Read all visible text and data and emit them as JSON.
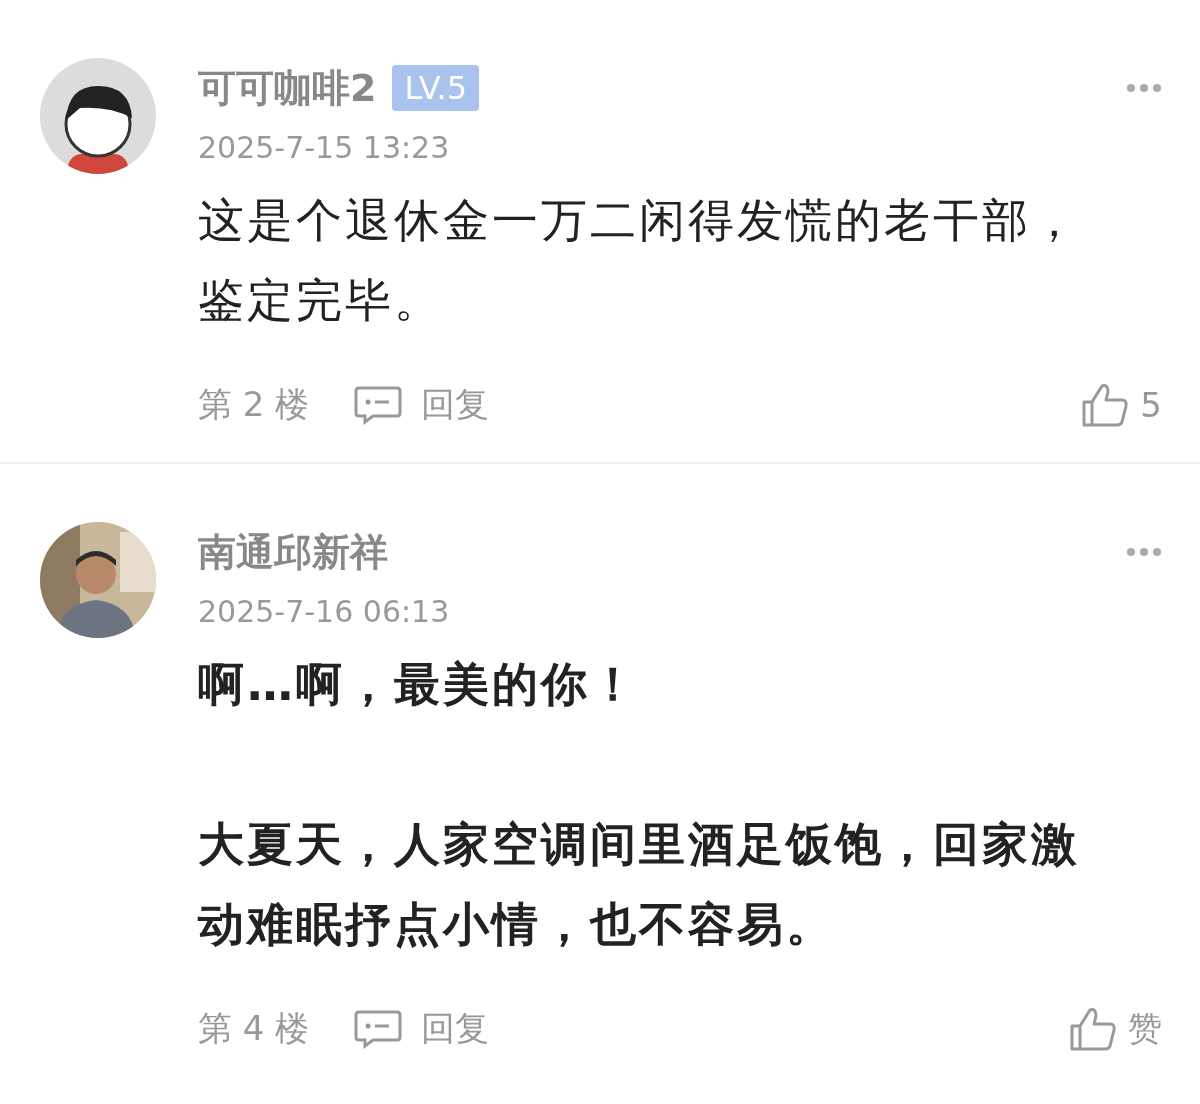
{
  "comments": [
    {
      "avatar": {
        "kind": "cartoon"
      },
      "username": "可可咖啡2",
      "level_badge": "LV.5",
      "time": "2025-7-15 13:23",
      "bold": false,
      "paragraphs": [
        "这是个退休金一万二闲得发慌的老干部，鉴定完毕。"
      ],
      "floor": "第 2 楼",
      "reply": "回复",
      "like_label": "5"
    },
    {
      "username": "南通邱新祥",
      "time": "2025-7-16 06:13",
      "bold": true,
      "paragraphs": [
        "啊…啊，最美的你！",
        "大夏天，人家空调间里酒足饭饱，回家激动难眠抒点小情，也不容易。"
      ],
      "floor": "第 4 楼",
      "reply": "回复",
      "like_label": "赞"
    }
  ]
}
